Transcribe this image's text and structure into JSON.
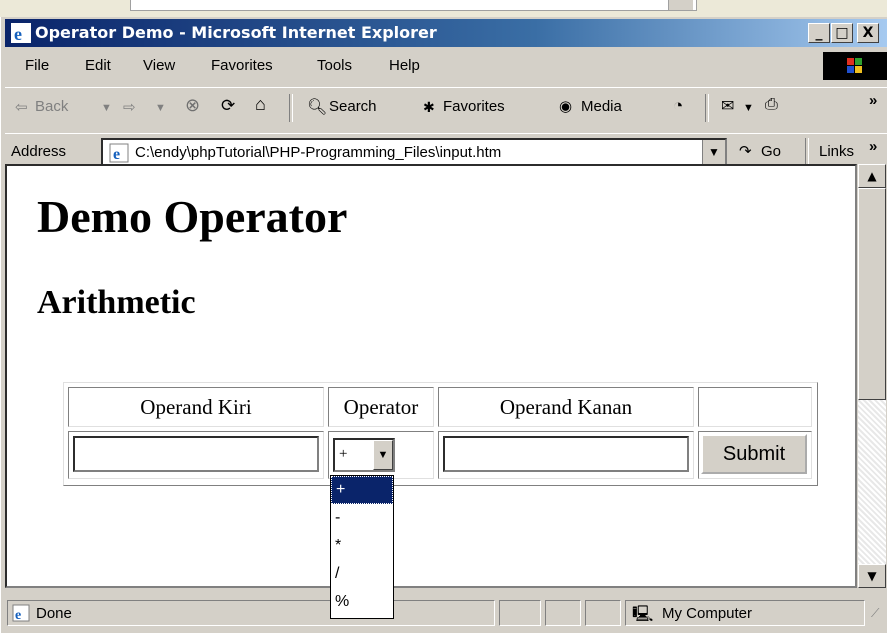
{
  "window": {
    "title": "Operator Demo - Microsoft Internet Explorer",
    "minimize": "_",
    "maximize": "□",
    "close": "X"
  },
  "menu": [
    "File",
    "Edit",
    "View",
    "Favorites",
    "Tools",
    "Help"
  ],
  "toolbar": {
    "back": "Back",
    "search": "Search",
    "favorites": "Favorites",
    "media": "Media",
    "chevron": "»"
  },
  "address": {
    "label": "Address",
    "value": "C:\\endy\\phpTutorial\\PHP-Programming_Files\\input.htm",
    "go": "Go",
    "links": "Links"
  },
  "page": {
    "heading": "Demo Operator",
    "subheading": "Arithmetic",
    "table": {
      "headers": [
        "Operand Kiri",
        "Operator",
        "Operand Kanan",
        ""
      ],
      "operator_selected": "+",
      "submit_label": "Submit"
    },
    "operator_options": [
      "+",
      "-",
      "*",
      "/",
      "%"
    ]
  },
  "status": {
    "text": "Done",
    "zone": "My Computer"
  },
  "colors": {
    "titlebar_start": "#0a246a",
    "titlebar_end": "#a6caf0",
    "chrome": "#d4d0c8",
    "selection": "#0a246a"
  }
}
